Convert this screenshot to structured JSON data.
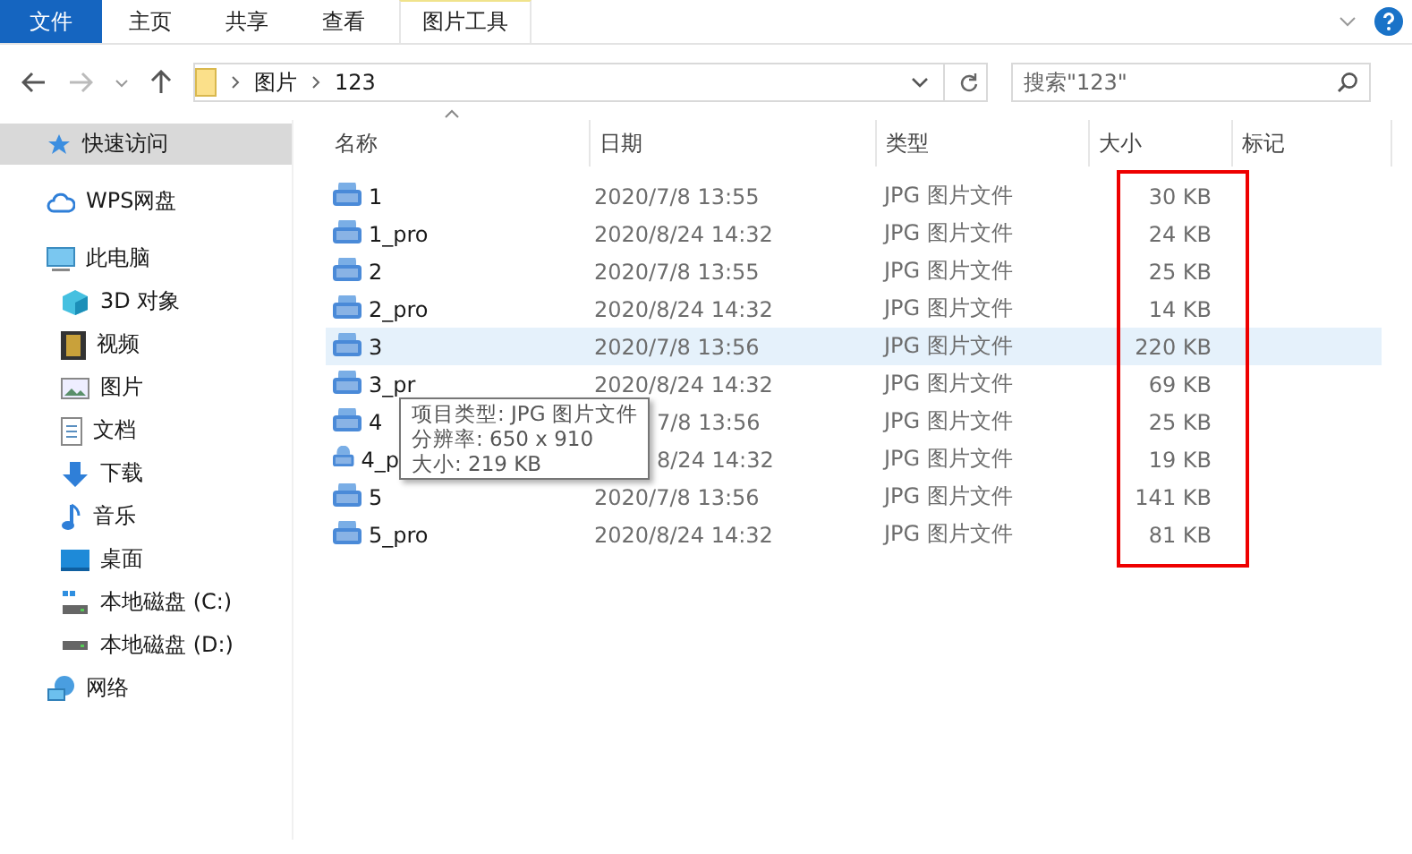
{
  "ribbon": {
    "tabs": [
      {
        "label": "文件",
        "kind": "file",
        "selected": false
      },
      {
        "label": "主页",
        "kind": "tab",
        "selected": false
      },
      {
        "label": "共享",
        "kind": "tab",
        "selected": false
      },
      {
        "label": "查看",
        "kind": "tab",
        "selected": false
      },
      {
        "label": "图片工具",
        "kind": "context",
        "selected": false
      }
    ]
  },
  "address": {
    "path": [
      "图片",
      "123"
    ]
  },
  "search": {
    "placeholder": "搜索\"123\""
  },
  "sidebar": {
    "items": [
      {
        "label": "快速访问",
        "selected": true
      },
      {
        "label": "WPS网盘",
        "selected": false
      },
      {
        "label": "此电脑",
        "selected": false,
        "children": [
          {
            "label": "3D 对象",
            "selected": false
          },
          {
            "label": "视频",
            "selected": false
          },
          {
            "label": "图片",
            "selected": false
          },
          {
            "label": "文档",
            "selected": false
          },
          {
            "label": "下载",
            "selected": false
          },
          {
            "label": "音乐",
            "selected": false
          },
          {
            "label": "桌面",
            "selected": false
          },
          {
            "label": "本地磁盘 (C:)",
            "selected": false
          },
          {
            "label": "本地磁盘 (D:)",
            "selected": false
          }
        ]
      },
      {
        "label": "网络",
        "selected": false
      }
    ]
  },
  "table": {
    "columns": [
      "名称",
      "日期",
      "类型",
      "大小",
      "标记"
    ],
    "rows": [
      {
        "name": "1",
        "date": "2020/7/8 13:55",
        "type": "JPG 图片文件",
        "size": "30 KB",
        "selected": false
      },
      {
        "name": "1_pro",
        "date": "2020/8/24 14:32",
        "type": "JPG 图片文件",
        "size": "24 KB",
        "selected": false
      },
      {
        "name": "2",
        "date": "2020/7/8 13:55",
        "type": "JPG 图片文件",
        "size": "25 KB",
        "selected": false
      },
      {
        "name": "2_pro",
        "date": "2020/8/24 14:32",
        "type": "JPG 图片文件",
        "size": "14 KB",
        "selected": false
      },
      {
        "name": "3",
        "date": "2020/7/8 13:56",
        "type": "JPG 图片文件",
        "size": "220 KB",
        "selected": true
      },
      {
        "name": "3_pr",
        "date": "2020/8/24 14:32",
        "type": "JPG 图片文件",
        "size": "69 KB",
        "selected": false
      },
      {
        "name": "4",
        "date": "7/8 13:56",
        "covered": true,
        "type": "JPG 图片文件",
        "size": "25 KB",
        "selected": false
      },
      {
        "name": "4_p",
        "date": "8/24 14:32",
        "covered": true,
        "type": "JPG 图片文件",
        "size": "19 KB",
        "selected": false
      },
      {
        "name": "5",
        "date": "2020/7/8 13:56",
        "type": "JPG 图片文件",
        "size": "141 KB",
        "selected": false
      },
      {
        "name": "5_pro",
        "date": "2020/8/24 14:32",
        "type": "JPG 图片文件",
        "size": "81 KB",
        "selected": false
      }
    ]
  },
  "tooltip": {
    "lines": [
      "项目类型: JPG 图片文件",
      "分辨率: 650 x 910",
      "大小: 219 KB"
    ]
  }
}
